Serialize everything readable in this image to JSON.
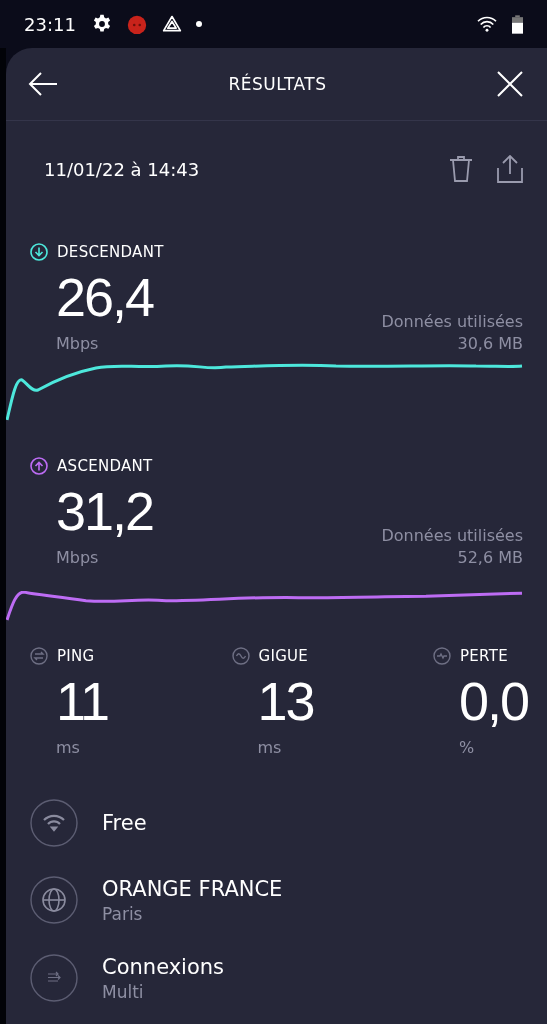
{
  "status_bar": {
    "time": "23:11"
  },
  "header": {
    "title": "RÉSULTATS"
  },
  "test": {
    "date": "11/01/22 à 14:43"
  },
  "speeds": [
    {
      "kind": "download",
      "label": "DESCENDANT",
      "value": "26,4",
      "unit": "Mbps",
      "data_label": "Données utilisées",
      "data_value": "30,6 MB",
      "color": "#4de8dc"
    },
    {
      "kind": "upload",
      "label": "ASCENDANT",
      "value": "31,2",
      "unit": "Mbps",
      "data_label": "Données utilisées",
      "data_value": "52,6 MB",
      "color": "#bd6cf4"
    }
  ],
  "metrics": [
    {
      "kind": "ping",
      "label": "PING",
      "value": "11",
      "unit": "ms"
    },
    {
      "kind": "jitter",
      "label": "GIGUE",
      "value": "13",
      "unit": "ms"
    },
    {
      "kind": "loss",
      "label": "PERTE",
      "value": "0,0",
      "unit": "%"
    }
  ],
  "info": [
    {
      "kind": "wifi",
      "title": "Free"
    },
    {
      "kind": "globe",
      "title": "ORANGE FRANCE",
      "subtitle": "Paris"
    },
    {
      "kind": "connections",
      "title": "Connexions",
      "subtitle": "Multi"
    }
  ]
}
